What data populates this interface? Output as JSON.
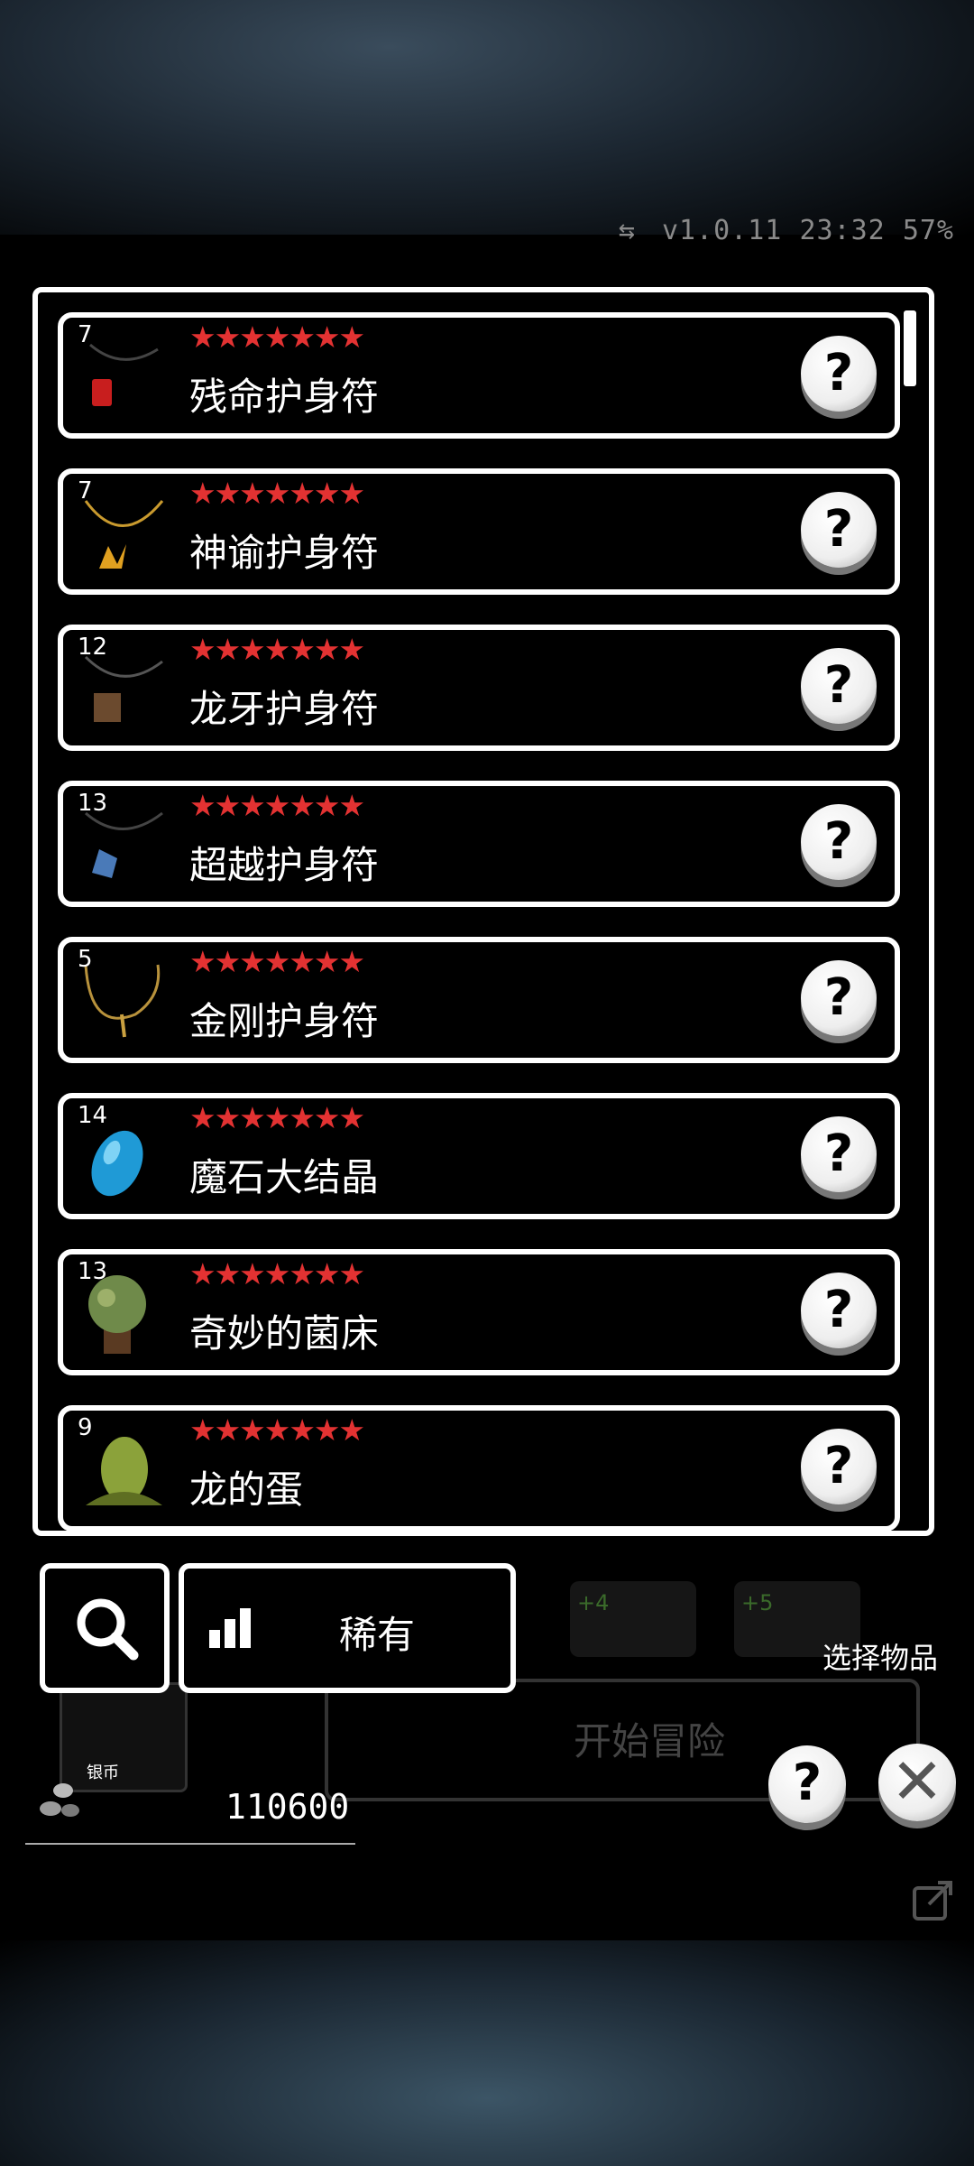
{
  "status": {
    "version": "v1.0.11",
    "time": "23:32",
    "battery": "57%"
  },
  "items": [
    {
      "count": "7",
      "stars": "★★★★★★★",
      "name": "残命护身符",
      "icon": "red-amulet-icon"
    },
    {
      "count": "7",
      "stars": "★★★★★★★",
      "name": "神谕护身符",
      "icon": "gold-amulet-icon"
    },
    {
      "count": "12",
      "stars": "★★★★★★★",
      "name": "龙牙护身符",
      "icon": "dragon-tooth-amulet-icon"
    },
    {
      "count": "13",
      "stars": "★★★★★★★",
      "name": "超越护身符",
      "icon": "blue-gem-amulet-icon"
    },
    {
      "count": "5",
      "stars": "★★★★★★★",
      "name": "金刚护身符",
      "icon": "vajra-amulet-icon"
    },
    {
      "count": "14",
      "stars": "★★★★★★★",
      "name": "魔石大结晶",
      "icon": "blue-crystal-icon"
    },
    {
      "count": "13",
      "stars": "★★★★★★★",
      "name": "奇妙的菌床",
      "icon": "fungus-bed-icon"
    },
    {
      "count": "9",
      "stars": "★★★★★★★",
      "name": "龙的蛋",
      "icon": "dragon-egg-icon"
    }
  ],
  "help_symbol": "?",
  "filter": {
    "label": "稀有"
  },
  "select_label": "选择物品",
  "start_label": "开始冒险",
  "bonus": {
    "plus4": "+4",
    "plus5": "+5"
  },
  "silver": {
    "label": "银币",
    "amount": "110600"
  },
  "close_symbol": "✕",
  "colors": {
    "star": "#e33232",
    "border": "#ffffff",
    "background": "#000000"
  }
}
